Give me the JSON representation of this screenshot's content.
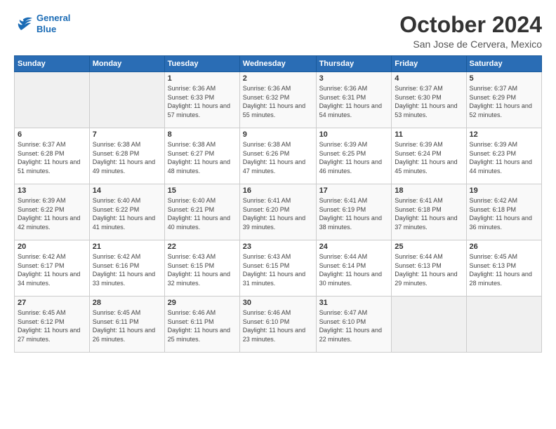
{
  "header": {
    "logo_line1": "General",
    "logo_line2": "Blue",
    "month_title": "October 2024",
    "location": "San Jose de Cervera, Mexico"
  },
  "weekdays": [
    "Sunday",
    "Monday",
    "Tuesday",
    "Wednesday",
    "Thursday",
    "Friday",
    "Saturday"
  ],
  "weeks": [
    [
      {
        "day": "",
        "info": ""
      },
      {
        "day": "",
        "info": ""
      },
      {
        "day": "1",
        "info": "Sunrise: 6:36 AM\nSunset: 6:33 PM\nDaylight: 11 hours and 57 minutes."
      },
      {
        "day": "2",
        "info": "Sunrise: 6:36 AM\nSunset: 6:32 PM\nDaylight: 11 hours and 55 minutes."
      },
      {
        "day": "3",
        "info": "Sunrise: 6:36 AM\nSunset: 6:31 PM\nDaylight: 11 hours and 54 minutes."
      },
      {
        "day": "4",
        "info": "Sunrise: 6:37 AM\nSunset: 6:30 PM\nDaylight: 11 hours and 53 minutes."
      },
      {
        "day": "5",
        "info": "Sunrise: 6:37 AM\nSunset: 6:29 PM\nDaylight: 11 hours and 52 minutes."
      }
    ],
    [
      {
        "day": "6",
        "info": "Sunrise: 6:37 AM\nSunset: 6:28 PM\nDaylight: 11 hours and 51 minutes."
      },
      {
        "day": "7",
        "info": "Sunrise: 6:38 AM\nSunset: 6:28 PM\nDaylight: 11 hours and 49 minutes."
      },
      {
        "day": "8",
        "info": "Sunrise: 6:38 AM\nSunset: 6:27 PM\nDaylight: 11 hours and 48 minutes."
      },
      {
        "day": "9",
        "info": "Sunrise: 6:38 AM\nSunset: 6:26 PM\nDaylight: 11 hours and 47 minutes."
      },
      {
        "day": "10",
        "info": "Sunrise: 6:39 AM\nSunset: 6:25 PM\nDaylight: 11 hours and 46 minutes."
      },
      {
        "day": "11",
        "info": "Sunrise: 6:39 AM\nSunset: 6:24 PM\nDaylight: 11 hours and 45 minutes."
      },
      {
        "day": "12",
        "info": "Sunrise: 6:39 AM\nSunset: 6:23 PM\nDaylight: 11 hours and 44 minutes."
      }
    ],
    [
      {
        "day": "13",
        "info": "Sunrise: 6:39 AM\nSunset: 6:22 PM\nDaylight: 11 hours and 42 minutes."
      },
      {
        "day": "14",
        "info": "Sunrise: 6:40 AM\nSunset: 6:22 PM\nDaylight: 11 hours and 41 minutes."
      },
      {
        "day": "15",
        "info": "Sunrise: 6:40 AM\nSunset: 6:21 PM\nDaylight: 11 hours and 40 minutes."
      },
      {
        "day": "16",
        "info": "Sunrise: 6:41 AM\nSunset: 6:20 PM\nDaylight: 11 hours and 39 minutes."
      },
      {
        "day": "17",
        "info": "Sunrise: 6:41 AM\nSunset: 6:19 PM\nDaylight: 11 hours and 38 minutes."
      },
      {
        "day": "18",
        "info": "Sunrise: 6:41 AM\nSunset: 6:18 PM\nDaylight: 11 hours and 37 minutes."
      },
      {
        "day": "19",
        "info": "Sunrise: 6:42 AM\nSunset: 6:18 PM\nDaylight: 11 hours and 36 minutes."
      }
    ],
    [
      {
        "day": "20",
        "info": "Sunrise: 6:42 AM\nSunset: 6:17 PM\nDaylight: 11 hours and 34 minutes."
      },
      {
        "day": "21",
        "info": "Sunrise: 6:42 AM\nSunset: 6:16 PM\nDaylight: 11 hours and 33 minutes."
      },
      {
        "day": "22",
        "info": "Sunrise: 6:43 AM\nSunset: 6:15 PM\nDaylight: 11 hours and 32 minutes."
      },
      {
        "day": "23",
        "info": "Sunrise: 6:43 AM\nSunset: 6:15 PM\nDaylight: 11 hours and 31 minutes."
      },
      {
        "day": "24",
        "info": "Sunrise: 6:44 AM\nSunset: 6:14 PM\nDaylight: 11 hours and 30 minutes."
      },
      {
        "day": "25",
        "info": "Sunrise: 6:44 AM\nSunset: 6:13 PM\nDaylight: 11 hours and 29 minutes."
      },
      {
        "day": "26",
        "info": "Sunrise: 6:45 AM\nSunset: 6:13 PM\nDaylight: 11 hours and 28 minutes."
      }
    ],
    [
      {
        "day": "27",
        "info": "Sunrise: 6:45 AM\nSunset: 6:12 PM\nDaylight: 11 hours and 27 minutes."
      },
      {
        "day": "28",
        "info": "Sunrise: 6:45 AM\nSunset: 6:11 PM\nDaylight: 11 hours and 26 minutes."
      },
      {
        "day": "29",
        "info": "Sunrise: 6:46 AM\nSunset: 6:11 PM\nDaylight: 11 hours and 25 minutes."
      },
      {
        "day": "30",
        "info": "Sunrise: 6:46 AM\nSunset: 6:10 PM\nDaylight: 11 hours and 23 minutes."
      },
      {
        "day": "31",
        "info": "Sunrise: 6:47 AM\nSunset: 6:10 PM\nDaylight: 11 hours and 22 minutes."
      },
      {
        "day": "",
        "info": ""
      },
      {
        "day": "",
        "info": ""
      }
    ]
  ]
}
